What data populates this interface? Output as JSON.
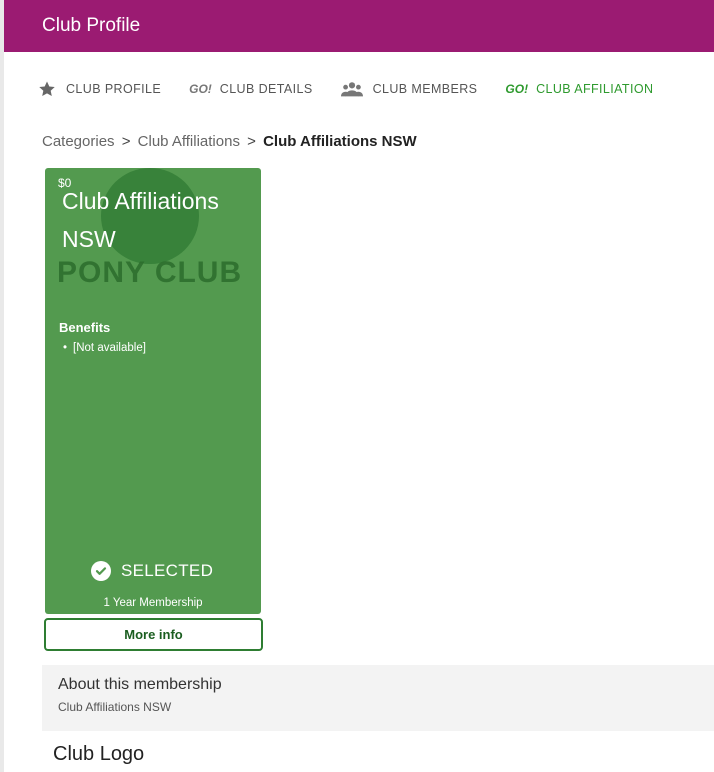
{
  "header": {
    "title": "Club Profile"
  },
  "tabs": [
    {
      "label": "CLUB PROFILE",
      "icon": "star-icon",
      "active": false
    },
    {
      "label": "CLUB DETAILS",
      "icon": "go-icon",
      "icon_text": "GO!",
      "active": false
    },
    {
      "label": "CLUB MEMBERS",
      "icon": "people-icon",
      "active": false
    },
    {
      "label": "CLUB AFFILIATION",
      "icon": "go-icon",
      "icon_text": "GO!",
      "active": true
    }
  ],
  "breadcrumb": {
    "items": [
      "Categories",
      "Club Affiliations"
    ],
    "separator": ">",
    "current": "Club Affiliations NSW"
  },
  "card": {
    "price": "$0",
    "title": "Club Affiliations NSW",
    "watermark": "PONY CLUB",
    "benefits_heading": "Benefits",
    "benefits": [
      "[Not available]"
    ],
    "status": "SELECTED",
    "duration": "1 Year Membership"
  },
  "more_info_label": "More info",
  "about": {
    "title": "About this membership",
    "subtitle": "Club Affiliations NSW"
  },
  "logo_heading": "Club Logo",
  "colors": {
    "header": "#9b1b72",
    "card": "#539a4f",
    "active_tab": "#2e9a2e",
    "button_border": "#2e7d32"
  }
}
